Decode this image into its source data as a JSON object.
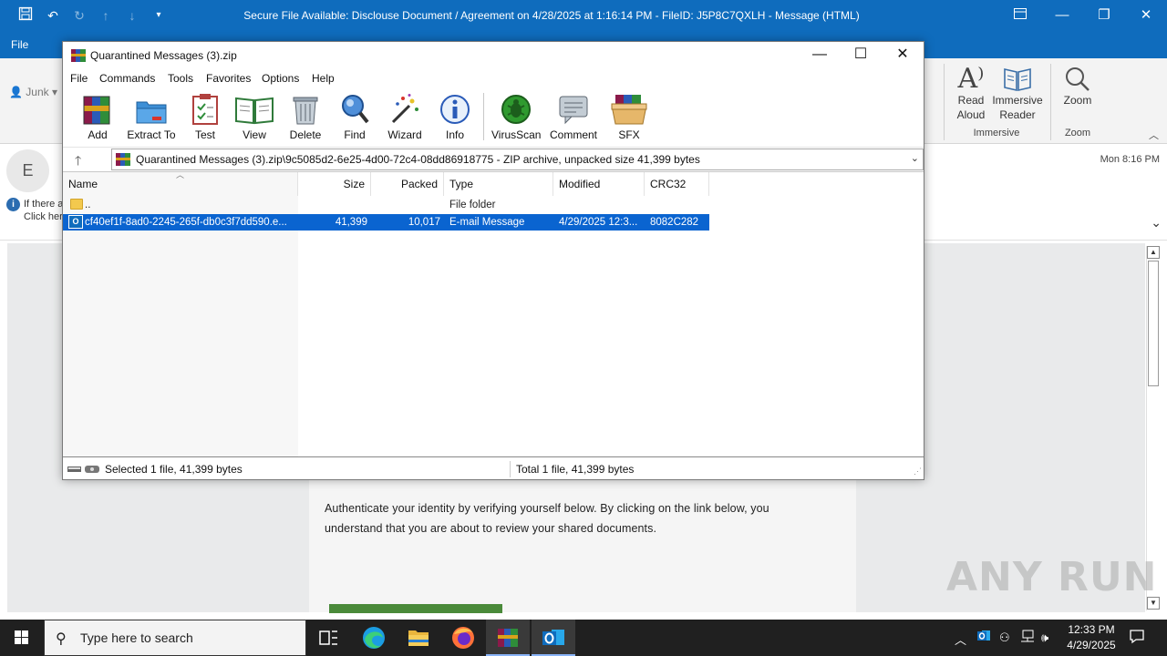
{
  "outlook": {
    "title": "Secure File Available: Disclouse Document / Agreement on 4/28/2025 at 1:16:14 PM - FileID: J5P8C7QXLH  -  Message (HTML)",
    "menu_file": "File",
    "junk_label": "Junk",
    "ribbon": {
      "read_aloud": [
        "Read",
        "Aloud"
      ],
      "immersive_reader": [
        "Immersive",
        "Reader"
      ],
      "zoom": "Zoom",
      "group_immersive": "Immersive",
      "group_zoom": "Zoom"
    },
    "sender_initial": "E",
    "info_line1": "If there a",
    "info_line2": "Click her",
    "date": "Mon 8:16 PM",
    "body_text": "Authenticate your identity by verifying yourself below. By clicking on the link below, you understand that you are about to review your shared documents.",
    "watermark": "ANY RUN"
  },
  "winrar": {
    "title": "Quarantined Messages (3).zip",
    "menu": [
      "File",
      "Commands",
      "Tools",
      "Favorites",
      "Options",
      "Help"
    ],
    "toolbar": [
      "Add",
      "Extract To",
      "Test",
      "View",
      "Delete",
      "Find",
      "Wizard",
      "Info",
      "VirusScan",
      "Comment",
      "SFX"
    ],
    "path": "Quarantined Messages (3).zip\\9c5085d2-6e25-4d00-72c4-08dd86918775 - ZIP archive, unpacked size 41,399 bytes",
    "columns": [
      "Name",
      "Size",
      "Packed",
      "Type",
      "Modified",
      "CRC32"
    ],
    "rows": [
      {
        "name": "..",
        "size": "",
        "packed": "",
        "type": "File folder",
        "modified": "",
        "crc": ""
      },
      {
        "name": "cf40ef1f-8ad0-2245-265f-db0c3f7dd590.e...",
        "size": "41,399",
        "packed": "10,017",
        "type": "E-mail Message",
        "modified": "4/29/2025 12:3...",
        "crc": "8082C282"
      }
    ],
    "status_left": "Selected 1 file, 41,399 bytes",
    "status_right": "Total 1 file, 41,399 bytes"
  },
  "taskbar": {
    "search_placeholder": "Type here to search",
    "time": "12:33 PM",
    "date": "4/29/2025"
  }
}
